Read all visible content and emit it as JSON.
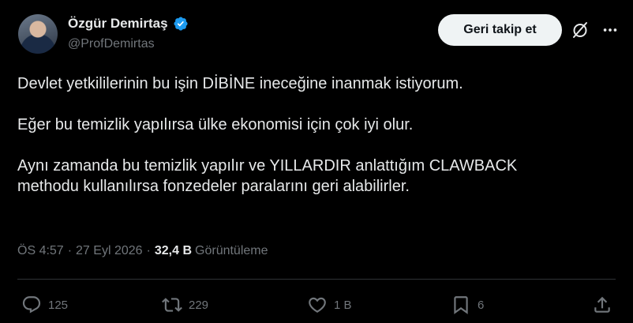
{
  "author": {
    "display_name": "Özgür Demirtaş",
    "handle": "@ProfDemirtas"
  },
  "header": {
    "follow_label": "Geri takip et"
  },
  "tweet": {
    "lines": [
      "Devlet yetkililerinin bu işin DİBİNE ineceğine inanmak istiyorum.",
      "Eğer bu temizlik yapılırsa ülke ekonomisi için çok iyi olur.",
      "Aynı zamanda bu temizlik yapılır ve YILLARDIR anlattığım CLAWBACK",
      "methodu kullanılırsa fonzedeler paralarını geri alabilirler."
    ]
  },
  "meta": {
    "time": "ÖS 4:57",
    "separator": "·",
    "date": "27 Eyl 2026",
    "views_count": "32,4 B",
    "views_label": "Görüntüleme"
  },
  "actions": {
    "replies": "125",
    "reposts": "229",
    "likes": "1 B",
    "bookmarks": "6"
  },
  "colors": {
    "background": "#000000",
    "text_primary": "#e7e9ea",
    "text_secondary": "#71767b",
    "verified_blue": "#1d9bf0",
    "button_bg": "#eff3f4"
  },
  "icons": [
    "verified-icon",
    "grok-icon",
    "more-icon",
    "reply-icon",
    "repost-icon",
    "like-icon",
    "bookmark-icon",
    "share-icon"
  ]
}
